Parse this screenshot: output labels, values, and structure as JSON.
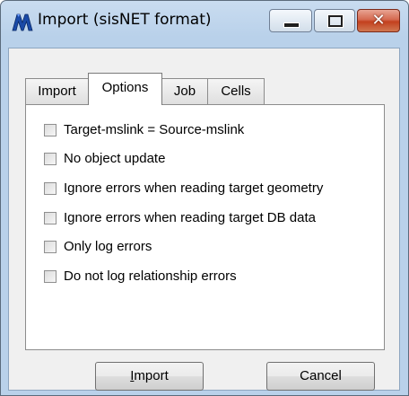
{
  "window": {
    "title": "Import (sisNET format)",
    "accent_close": "#c3401e",
    "frame_color": "#b9d1ea"
  },
  "icons": {
    "app": "sisnet-app-icon",
    "minimize": "minimize-icon",
    "maximize": "maximize-icon",
    "close": "close-icon"
  },
  "tabs": [
    {
      "label": "Import",
      "active": false
    },
    {
      "label": "Options",
      "active": true
    },
    {
      "label": "Job",
      "active": false
    },
    {
      "label": "Cells",
      "active": false
    }
  ],
  "options": [
    {
      "label": "Target-mslink = Source-mslink",
      "checked": false
    },
    {
      "label": "No object update",
      "checked": false
    },
    {
      "label": "Ignore errors when reading target geometry",
      "checked": false
    },
    {
      "label": "Ignore errors when reading target DB data",
      "checked": false
    },
    {
      "label": "Only log errors",
      "checked": false
    },
    {
      "label": "Do not log relationship errors",
      "checked": false
    }
  ],
  "buttons": {
    "import_label": "Import",
    "cancel_label": "Cancel"
  }
}
